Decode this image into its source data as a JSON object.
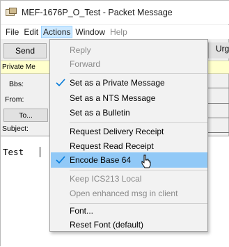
{
  "window": {
    "title": "MEF-1676P_O_Test - Packet Message"
  },
  "menubar": [
    {
      "label": "File",
      "active": false,
      "disabled": false
    },
    {
      "label": "Edit",
      "active": false,
      "disabled": false
    },
    {
      "label": "Actions",
      "active": true,
      "disabled": false
    },
    {
      "label": "Window",
      "active": false,
      "disabled": false
    },
    {
      "label": "Help",
      "active": false,
      "disabled": true
    }
  ],
  "toolbar": {
    "send_label": "Send",
    "urgency_label": "Urg"
  },
  "form": {
    "private_banner": "Private Me",
    "bbs_label": "Bbs:",
    "from_label": "From:",
    "to_label": "To...",
    "subject_label": "Subject:"
  },
  "message": {
    "body": "Test"
  },
  "actions_menu": {
    "reply": "Reply",
    "forward": "Forward",
    "set_private": "Set as a Private Message",
    "set_nts": "Set as a NTS Message",
    "set_bulletin": "Set as a Bulletin",
    "request_delivery": "Request Delivery Receipt",
    "request_read": "Request Read Receipt",
    "encode_base64": "Encode Base 64",
    "keep_ics213": "Keep ICS213 Local",
    "open_enhanced": "Open enhanced msg in client",
    "font": "Font...",
    "reset_font": "Reset Font (default)"
  },
  "colors": {
    "highlight": "#91c9f7",
    "check": "#0078d7",
    "private_strip": "#ffffcc"
  }
}
